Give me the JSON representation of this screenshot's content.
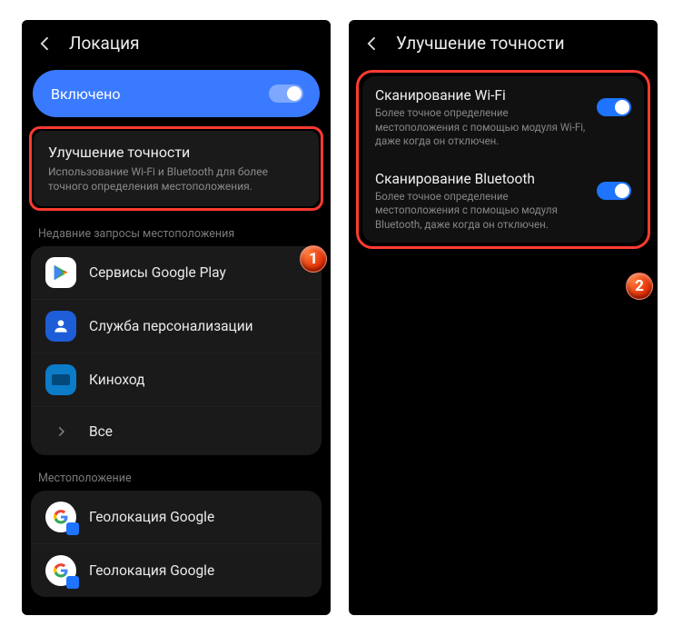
{
  "left": {
    "header": "Локация",
    "enabled_label": "Включено",
    "improve": {
      "title": "Улучшение точности",
      "sub": "Использование Wi-Fi и Bluetooth для более точного определения местоположения."
    },
    "recent_header": "Недавние запросы местоположения",
    "apps": {
      "gplay": "Сервисы Google Play",
      "personalization": "Служба персонализации",
      "kinohod": "Киноход",
      "all": "Все"
    },
    "location_header": "Местоположение",
    "geo1": "Геолокация Google",
    "geo2": "Геолокация Google"
  },
  "right": {
    "header": "Улучшение точности",
    "wifi": {
      "title": "Сканирование Wi-Fi",
      "sub": "Более точное определение местоположения с помощью модуля Wi-Fi, даже когда он отключен."
    },
    "bt": {
      "title": "Сканирование Bluetooth",
      "sub": "Более точное определение местоположения с помощью модуля Bluetooth, даже когда он отключен."
    }
  },
  "badges": {
    "one": "1",
    "two": "2"
  }
}
